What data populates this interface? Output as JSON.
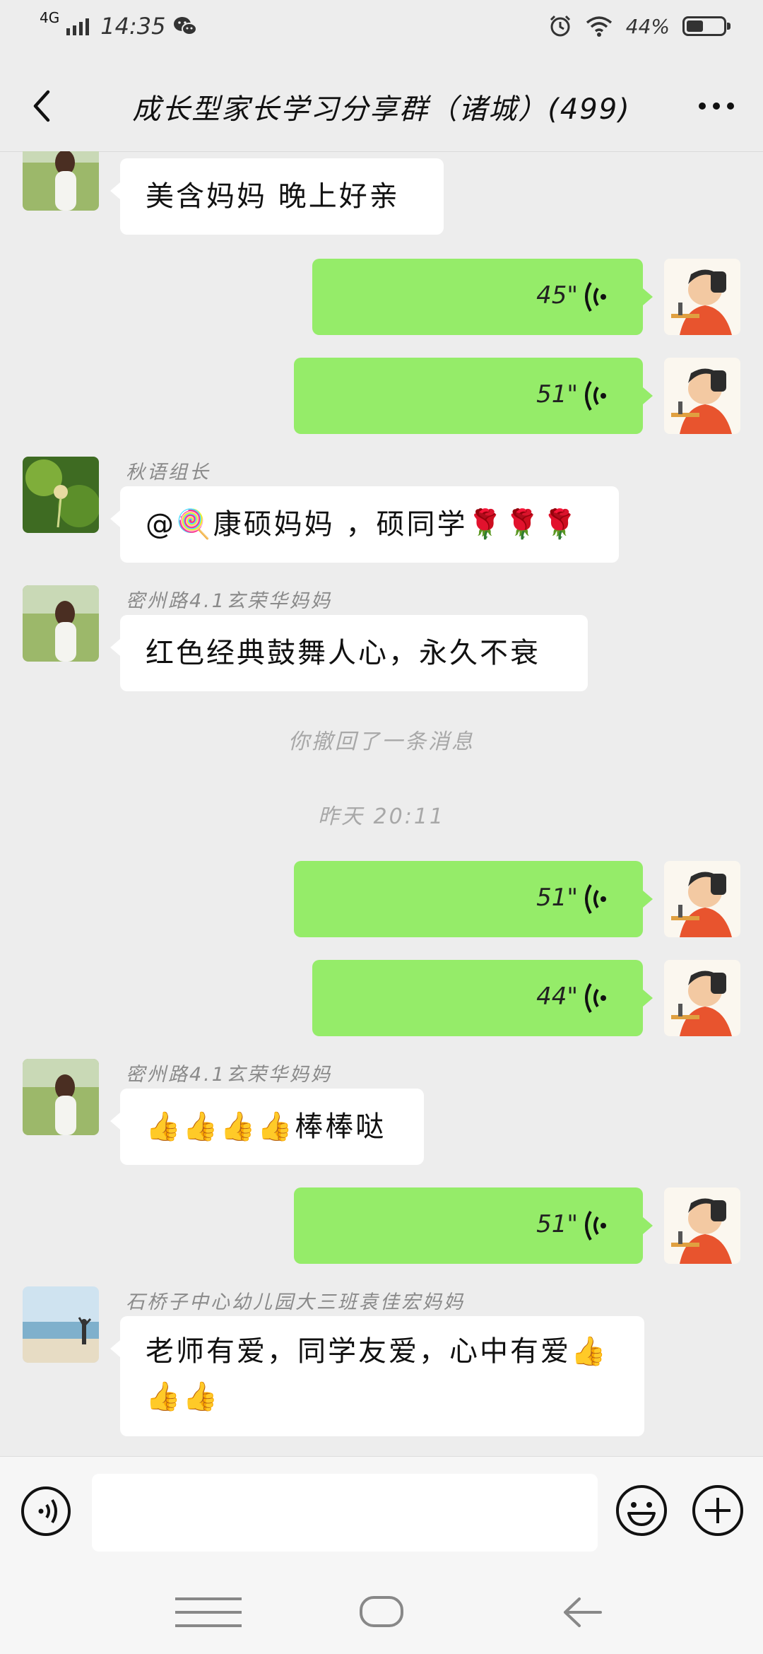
{
  "status_bar": {
    "network": "4G",
    "time": "14:35",
    "battery": "44%",
    "battery_level": 0.44
  },
  "header": {
    "title": "成长型家长学习分享群（诸城）(499)"
  },
  "messages": {
    "m1": {
      "text": "美含妈妈  晚上好亲"
    },
    "m2": {
      "duration": "45\""
    },
    "m3": {
      "duration": "51\""
    },
    "m4": {
      "sender": "秋语组长",
      "text": "@🍭康硕妈妈 ，硕同学🌹🌹🌹"
    },
    "m5": {
      "sender": "密州路4.1玄荣华妈妈",
      "text": "红色经典鼓舞人心，永久不衰"
    },
    "recall": "你撤回了一条消息",
    "timestamp": "昨天 20:11",
    "m6": {
      "duration": "51\""
    },
    "m7": {
      "duration": "44\""
    },
    "m8": {
      "sender": "密州路4.1玄荣华妈妈",
      "text": "👍👍👍👍棒棒哒"
    },
    "m9": {
      "duration": "51\""
    },
    "m10": {
      "sender": "石桥子中心幼儿园大三班袁佳宏妈妈",
      "text_line1": "老师有爱，同学友爱，心中有爱👍",
      "text_line2": "👍👍"
    }
  },
  "input": {
    "placeholder": ""
  },
  "colors": {
    "outgoing_bubble": "#95ec69",
    "incoming_bubble": "#ffffff",
    "background": "#ededed"
  }
}
